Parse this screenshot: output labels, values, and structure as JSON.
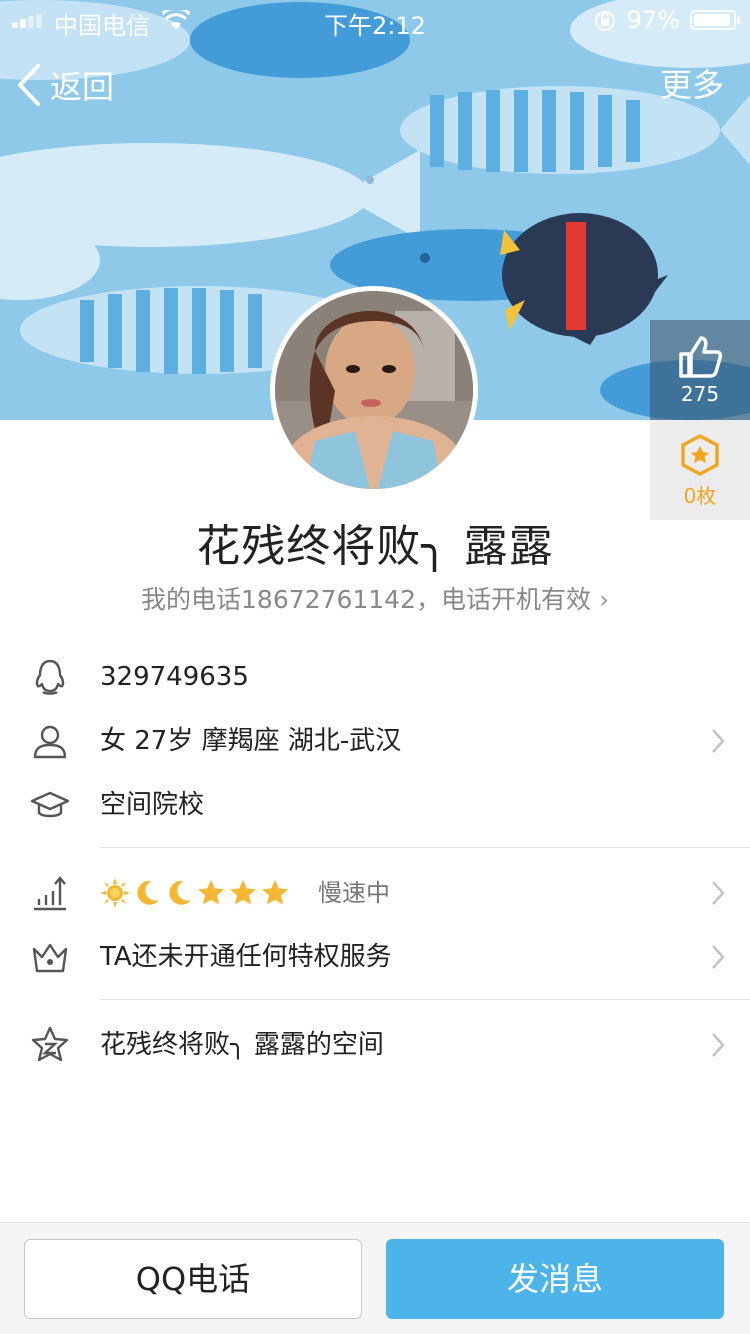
{
  "status": {
    "carrier": "中国电信",
    "time": "下午2:12",
    "battery": "97%"
  },
  "nav": {
    "back_label": "返回",
    "more_label": "更多"
  },
  "likes": {
    "count": "275"
  },
  "badges": {
    "count": "0枚"
  },
  "profile": {
    "name": "花残终将败╮ 露露",
    "signature": "我的电话18672761142，电话开机有效",
    "signature_arrow": "›"
  },
  "info": {
    "qq": "329749635",
    "basic": "女 27岁 摩羯座 湖北-武汉",
    "school": "空间院校",
    "level_status": "慢速中",
    "privilege": "TA还未开通任何特权服务",
    "space": "花残终将败╮ 露露的空间"
  },
  "level_icons": [
    "sun-icon",
    "moon-icon",
    "moon-icon",
    "star-icon",
    "star-icon",
    "star-icon"
  ],
  "actions": {
    "call": "QQ电话",
    "message": "发消息"
  },
  "colors": {
    "primary_button": "#4db4ea",
    "banner_bg": "#8fc9ea",
    "badge_gold": "#f2a51e"
  }
}
